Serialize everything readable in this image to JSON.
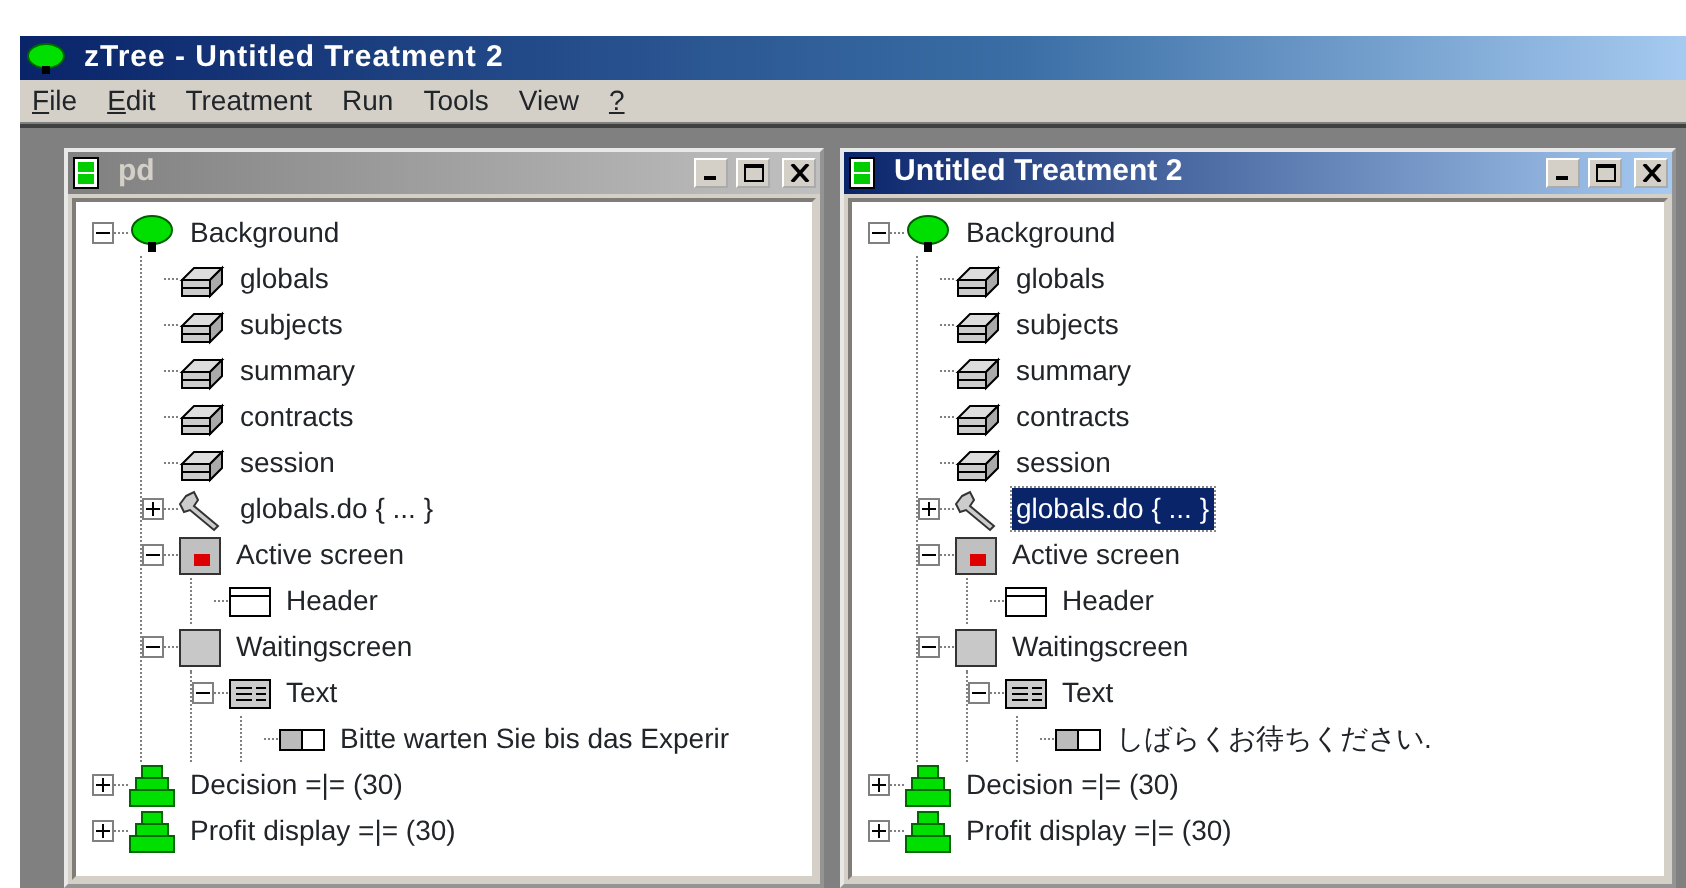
{
  "window": {
    "title": "zTree - Untitled Treatment 2"
  },
  "menu": [
    {
      "label": "File",
      "underline_first": true
    },
    {
      "label": "Edit",
      "underline_first": true
    },
    {
      "label": "Treatment",
      "underline_first": false
    },
    {
      "label": "Run",
      "underline_first": false
    },
    {
      "label": "Tools",
      "underline_first": false
    },
    {
      "label": "View",
      "underline_first": false
    },
    {
      "label": "?",
      "underline_first": true
    }
  ],
  "documents": [
    {
      "title": "pd",
      "active": false,
      "tree": [
        {
          "label": "Background",
          "kind": "tree",
          "expanded": true,
          "selected": false,
          "children": [
            {
              "label": "globals",
              "kind": "table",
              "selected": false
            },
            {
              "label": "subjects",
              "kind": "table",
              "selected": false
            },
            {
              "label": "summary",
              "kind": "table",
              "selected": false
            },
            {
              "label": "contracts",
              "kind": "table",
              "selected": false
            },
            {
              "label": "session",
              "kind": "table",
              "selected": false
            },
            {
              "label": "globals.do { ... }",
              "kind": "program",
              "expanded": false,
              "selected": false
            },
            {
              "label": "Active screen",
              "kind": "screen",
              "expanded": true,
              "selected": false,
              "children": [
                {
                  "label": "Header",
                  "kind": "header",
                  "selected": false
                }
              ]
            },
            {
              "label": "Waitingscreen",
              "kind": "box",
              "expanded": true,
              "selected": false,
              "children": [
                {
                  "label": "Text",
                  "kind": "textbox",
                  "expanded": true,
                  "selected": false,
                  "children": [
                    {
                      "label": "Bitte warten Sie bis das Experir",
                      "kind": "item",
                      "selected": false
                    }
                  ]
                }
              ]
            }
          ]
        },
        {
          "label": "Decision =|= (30)",
          "kind": "stage",
          "expanded": false,
          "selected": false
        },
        {
          "label": "Profit display =|= (30)",
          "kind": "stage",
          "expanded": false,
          "selected": false
        }
      ]
    },
    {
      "title": "Untitled Treatment 2",
      "active": true,
      "tree": [
        {
          "label": "Background",
          "kind": "tree",
          "expanded": true,
          "selected": false,
          "children": [
            {
              "label": "globals",
              "kind": "table",
              "selected": false
            },
            {
              "label": "subjects",
              "kind": "table",
              "selected": false
            },
            {
              "label": "summary",
              "kind": "table",
              "selected": false
            },
            {
              "label": "contracts",
              "kind": "table",
              "selected": false
            },
            {
              "label": "session",
              "kind": "table",
              "selected": false
            },
            {
              "label": "globals.do { ... }",
              "kind": "program",
              "expanded": false,
              "selected": true
            },
            {
              "label": "Active screen",
              "kind": "screen",
              "expanded": true,
              "selected": false,
              "children": [
                {
                  "label": "Header",
                  "kind": "header",
                  "selected": false
                }
              ]
            },
            {
              "label": "Waitingscreen",
              "kind": "box",
              "expanded": true,
              "selected": false,
              "children": [
                {
                  "label": "Text",
                  "kind": "textbox",
                  "expanded": true,
                  "selected": false,
                  "children": [
                    {
                      "label": "しばらくお待ちください.",
                      "kind": "item",
                      "selected": false
                    }
                  ]
                }
              ]
            }
          ]
        },
        {
          "label": "Decision =|= (30)",
          "kind": "stage",
          "expanded": false,
          "selected": false
        },
        {
          "label": "Profit display =|= (30)",
          "kind": "stage",
          "expanded": false,
          "selected": false
        }
      ]
    }
  ]
}
